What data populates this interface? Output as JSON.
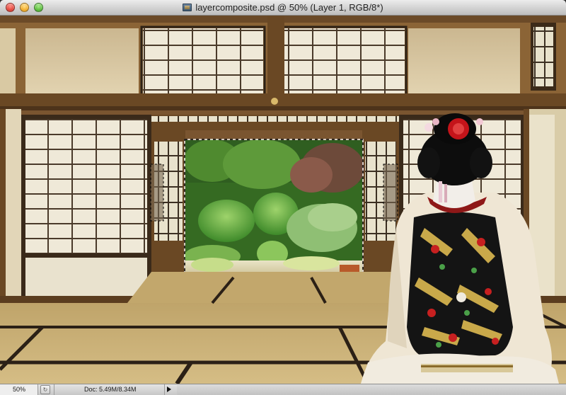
{
  "window": {
    "title": "layercomposite.psd @ 50% (Layer 1, RGB/8*)",
    "buttons": [
      "close",
      "minimize",
      "zoom"
    ],
    "document_icon": "psd-file-icon"
  },
  "status_bar": {
    "zoom": "50%",
    "doc_info": "Doc: 5.49M/8.34M"
  },
  "canvas": {
    "content": "composite photo of a kimono-clad figure kneeling in a tatami room facing an open garden",
    "selection": "marching-ants around garden opening"
  },
  "colors": {
    "titlebar": "#d2d2d2",
    "statusbar": "#c7c7c7",
    "wood": "#5a3a1e",
    "tatami": "#c8ad73",
    "shoji": "#eee6d2",
    "garden": "#3d7a2a"
  }
}
